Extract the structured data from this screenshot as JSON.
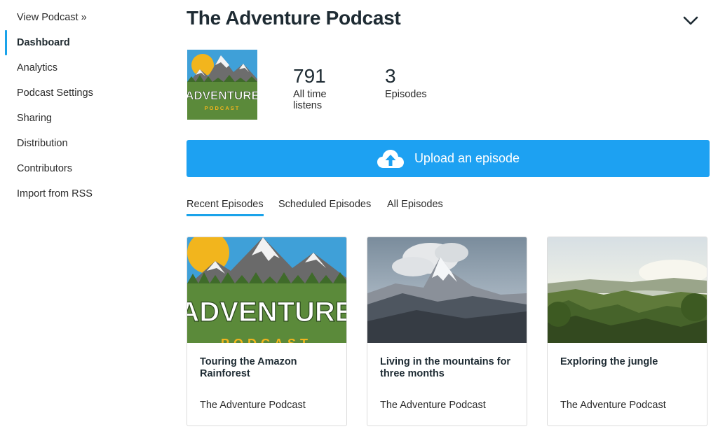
{
  "sidebar": {
    "view_podcast": "View Podcast »",
    "items": [
      {
        "label": "Dashboard",
        "active": true
      },
      {
        "label": "Analytics"
      },
      {
        "label": "Podcast Settings"
      },
      {
        "label": "Sharing"
      },
      {
        "label": "Distribution"
      },
      {
        "label": "Contributors"
      },
      {
        "label": "Import from RSS"
      }
    ]
  },
  "header": {
    "title": "The Adventure Podcast",
    "menu_icon": "chevron-down-icon"
  },
  "podcast_art": {
    "word": "ADVENTURE",
    "sub": "PODCAST"
  },
  "stats": [
    {
      "value": "791",
      "label_line1": "All time",
      "label_line2": "listens"
    },
    {
      "value": "3",
      "label_line1": "Episodes",
      "label_line2": ""
    }
  ],
  "upload": {
    "label": "Upload an episode",
    "icon": "cloud-upload-icon"
  },
  "tabs": [
    {
      "label": "Recent Episodes",
      "active": true
    },
    {
      "label": "Scheduled Episodes"
    },
    {
      "label": "All Episodes"
    }
  ],
  "episodes": [
    {
      "title": "Touring the Amazon Rainforest",
      "podcast": "The Adventure Podcast",
      "image": "adventure-podcast-art"
    },
    {
      "title": "Living in the mountains for three months",
      "podcast": "The Adventure Podcast",
      "image": "mountain-photo"
    },
    {
      "title": "Exploring the jungle",
      "podcast": "The Adventure Podcast",
      "image": "jungle-photo"
    }
  ],
  "colors": {
    "accent": "#1da1f2",
    "title": "#1e2b33",
    "art_green": "#5b8a3a",
    "art_sky": "#3fa0d8",
    "art_sun": "#f2b51d"
  }
}
